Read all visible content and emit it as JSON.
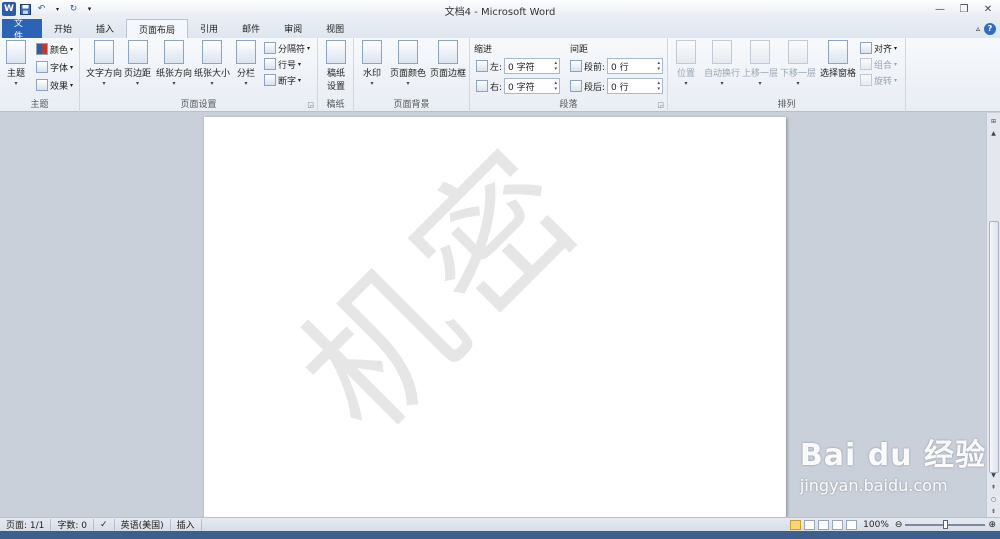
{
  "titlebar": {
    "title": "文档4 - Microsoft Word",
    "app_icon": "W",
    "qat": [
      "save-icon",
      "undo-icon",
      "redo-icon",
      "customize-qat-icon"
    ]
  },
  "tabs": {
    "file": "文件",
    "items": [
      "开始",
      "插入",
      "页面布局",
      "引用",
      "邮件",
      "审阅",
      "视图"
    ],
    "active": "页面布局"
  },
  "ribbon": {
    "theme": {
      "label": "主题",
      "main": "主题",
      "colors": "颜色",
      "fonts": "字体",
      "effects": "效果"
    },
    "page_setup": {
      "label": "页面设置",
      "text_direction": "文字方向",
      "margins": "页边距",
      "orientation": "纸张方向",
      "size": "纸张大小",
      "columns": "分栏",
      "breaks": "分隔符",
      "line_numbers": "行号",
      "hyphenation": "断字"
    },
    "manuscript": {
      "label": "稿纸",
      "settings_line1": "稿纸",
      "settings_line2": "设置"
    },
    "page_background": {
      "label": "页面背景",
      "watermark": "水印",
      "page_color": "页面颜色",
      "page_borders": "页面边框"
    },
    "paragraph": {
      "label": "段落",
      "indent_title": "缩进",
      "spacing_title": "间距",
      "left_label": "左:",
      "left_value": "0 字符",
      "right_label": "右:",
      "right_value": "0 字符",
      "before_label": "段前:",
      "before_value": "0 行",
      "after_label": "段后:",
      "after_value": "0 行"
    },
    "arrange": {
      "label": "排列",
      "position": "位置",
      "wrap_text": "自动换行",
      "bring_forward": "上移一层",
      "send_backward": "下移一层",
      "selection_pane": "选择窗格",
      "align": "对齐",
      "group": "组合",
      "rotate": "旋转"
    }
  },
  "document": {
    "watermark_text": "机密"
  },
  "overlay": {
    "brand": "Bai du 经验",
    "url": "jingyan.baidu.com"
  },
  "statusbar": {
    "page": "页面: 1/1",
    "words": "字数: 0",
    "language": "英语(美国)",
    "mode": "插入",
    "zoom": "100%",
    "zoom_level": 1.0
  },
  "colors": {
    "file_tab": "#2b64b6",
    "workspace": "#c9d0da",
    "watermark": "#e6e6e6"
  }
}
